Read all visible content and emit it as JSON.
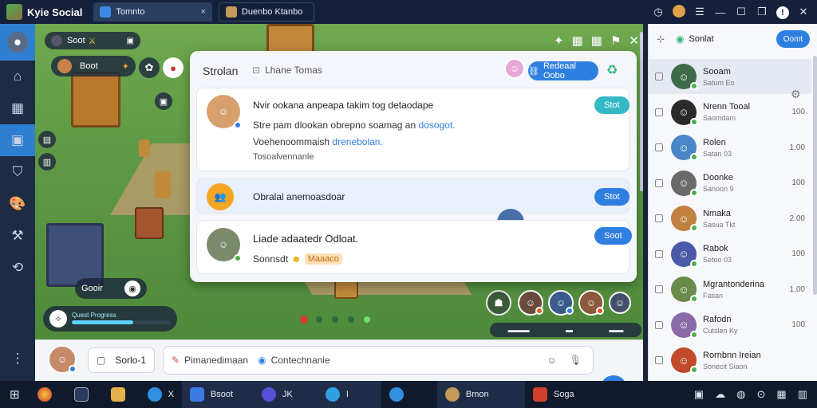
{
  "titlebar": {
    "app_title": "Kyie Social",
    "tabs": [
      {
        "label": "Tomnto",
        "close": "×"
      },
      {
        "label": "Duenbo Ktanbo"
      }
    ]
  },
  "game": {
    "player_pill": "Soot",
    "coins_pill": "Boot",
    "goal_label": "Gooir",
    "progress_label": "Quest Progress",
    "progress": 0.62
  },
  "panel": {
    "title": "Strolan",
    "tab_label": "Lhane Tomas",
    "header_button": "Redeaal Oobo",
    "posts": [
      {
        "title": "Nvir ookana anpeapa takim tog detaodape",
        "line2": "Stre pam dlookan obrepno soamag an",
        "line2_link": "dosogot.",
        "line3": "Voehenoommaish",
        "line3_link": "drenebolan.",
        "line4": "Tosoalvennanle",
        "button": "Stot"
      },
      {
        "title": "Obralal anemoasdoar",
        "button": "Stot"
      },
      {
        "title": "Liade adaatedr Odloat.",
        "line2": "Sonnsdt",
        "badge": "Maaaco",
        "button": "Soot"
      }
    ]
  },
  "bottombar": {
    "compose_label": "Sorlo-1",
    "input_placeholder": "Pimanedimaan",
    "input_tag": "Contechnanie"
  },
  "friends": {
    "title": "Sonlat",
    "action_button": "Oomt",
    "list": [
      {
        "name": "Sooam",
        "status": "Satum Eo",
        "time": ""
      },
      {
        "name": "Nrenn Tooal",
        "status": "Saomdam",
        "time": "100"
      },
      {
        "name": "Rolen",
        "status": "Satan 03",
        "time": "1.00"
      },
      {
        "name": "Doonke",
        "status": "Sanoon 9",
        "time": "100"
      },
      {
        "name": "Nmaka",
        "status": "Sasua Tkt",
        "time": "2.00"
      },
      {
        "name": "Rabok",
        "status": "Setoo 03",
        "time": "100"
      },
      {
        "name": "Mgrantonderina",
        "status": "Fatian",
        "time": "1.00"
      },
      {
        "name": "Rafodn",
        "status": "Cutslen Ky",
        "time": "100"
      },
      {
        "name": "Rornbnn Ireian",
        "status": "Sonecit  Siaon",
        "time": ""
      }
    ]
  },
  "taskbar": {
    "items": [
      "Bsoot",
      "JK",
      "I",
      "",
      "Bmon",
      "Soga"
    ],
    "close_mark": "X"
  },
  "colors": {
    "accent": "#2f7fe0",
    "teal": "#35b8c6",
    "online": "#4caf50",
    "titlebar": "#15213a",
    "sidebar_active": "#2f7fd0"
  }
}
